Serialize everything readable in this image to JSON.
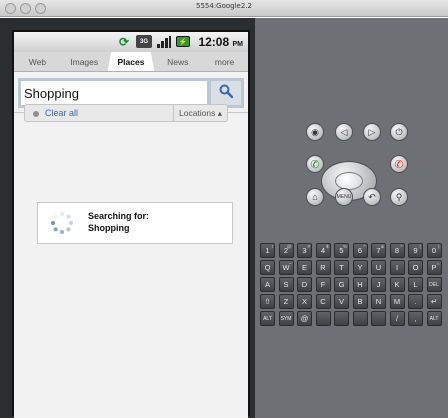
{
  "window": {
    "title": "5554:Google2.2"
  },
  "statusbar": {
    "time": "12:08",
    "ampm": "PM",
    "network": "3G"
  },
  "tabs": [
    {
      "label": "Web",
      "active": false
    },
    {
      "label": "Images",
      "active": false
    },
    {
      "label": "Places",
      "active": true
    },
    {
      "label": "News",
      "active": false
    },
    {
      "label": "more",
      "active": false
    }
  ],
  "search": {
    "value": "Shopping",
    "button_icon": "search-icon"
  },
  "filter_bar": {
    "clear_label": "Clear all",
    "locations_label": "Locations ▴"
  },
  "dialog": {
    "line1": "Searching for:",
    "line2": "Shopping"
  },
  "keyboard": {
    "row1": [
      "1",
      "2",
      "3",
      "4",
      "5",
      "6",
      "7",
      "8",
      "9",
      "0"
    ],
    "row1_sup": [
      "!",
      "@",
      "#",
      "$",
      "%",
      "^",
      "&",
      "*",
      "(",
      ")"
    ],
    "row2": [
      "Q",
      "W",
      "E",
      "R",
      "T",
      "Y",
      "U",
      "I",
      "O",
      "P"
    ],
    "row2_sup": [
      "",
      "~",
      "",
      "",
      "",
      "",
      "",
      "",
      "",
      "="
    ],
    "row3": [
      "A",
      "S",
      "D",
      "F",
      "G",
      "H",
      "J",
      "K",
      "L",
      "DEL"
    ],
    "row3_sup": [
      "",
      "",
      "",
      "",
      "",
      "",
      "",
      "",
      "",
      ""
    ],
    "row4": [
      "⇧",
      "Z",
      "X",
      "C",
      "V",
      "B",
      "N",
      "M",
      ".",
      "↵"
    ],
    "row4_sup": [
      "",
      "",
      "",
      "",
      "",
      "",
      "",
      "",
      "",
      ""
    ],
    "row5": [
      "ALT",
      "SYM",
      "@",
      "",
      "",
      "",
      "",
      "/",
      ",",
      "ALT"
    ]
  },
  "colors": {
    "accent": "#3a66b4",
    "emulator_bg": "#6d7175"
  }
}
